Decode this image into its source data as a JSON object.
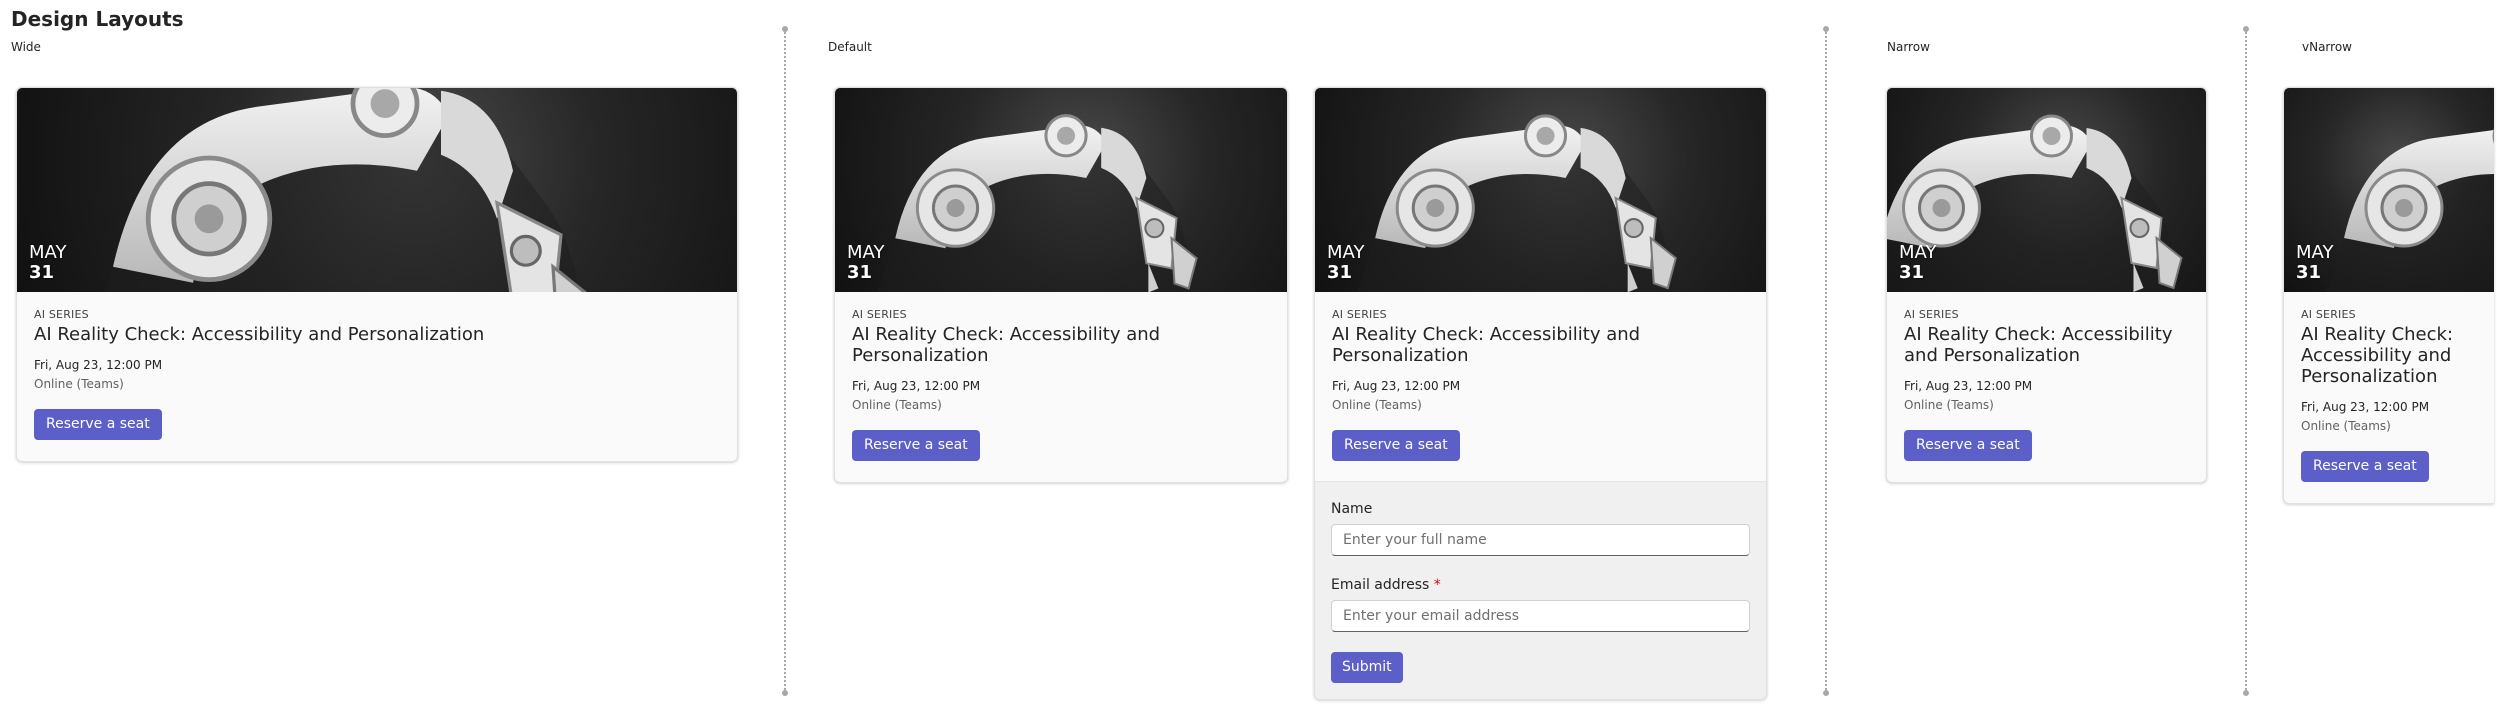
{
  "page": {
    "title": "Design Layouts"
  },
  "sections": {
    "wide": "Wide",
    "default": "Default",
    "narrow": "Narrow",
    "vnarrow": "vNarrow"
  },
  "event": {
    "month": "MAY",
    "day": "31",
    "series": "AI SERIES",
    "title": "AI Reality Check: Accessibility and Personalization",
    "datetime": "Fri, Aug 23, 12:00 PM",
    "location": "Online (Teams)",
    "reserve_label": "Reserve a seat"
  },
  "form": {
    "name_label": "Name",
    "name_placeholder": "Enter your full name",
    "email_label": "Email address",
    "required_marker": "*",
    "email_placeholder": "Enter your email address",
    "submit_label": "Submit"
  },
  "colors": {
    "accent": "#5b5fc7",
    "required": "#c50f1f",
    "card_background": "#fafafa"
  }
}
